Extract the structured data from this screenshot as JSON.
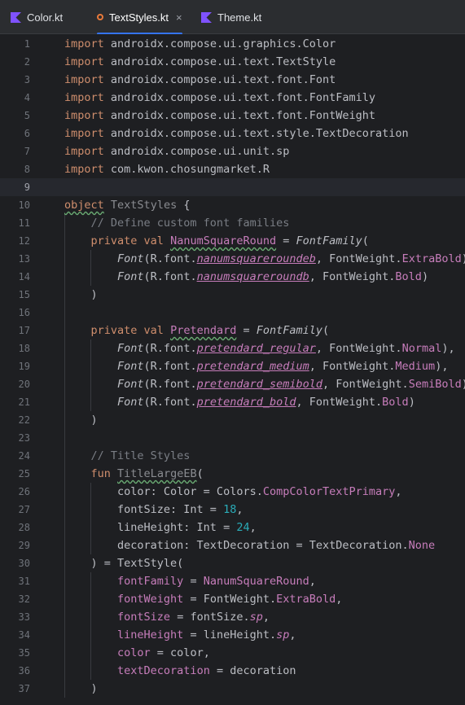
{
  "tabs": [
    {
      "label": "Color.kt",
      "active": false,
      "modified": false
    },
    {
      "label": "TextStyles.kt",
      "active": true,
      "modified": true
    },
    {
      "label": "Theme.kt",
      "active": false,
      "modified": false
    }
  ],
  "colors": {
    "accent": "#3574f0",
    "modified": "#e8793a",
    "kotlin_icon": "#7f52ff"
  },
  "current_line": 9,
  "lines": [
    [
      {
        "t": "import",
        "c": "kw"
      },
      {
        "t": " androidx.compose.ui.graphics.Color",
        "c": "plain"
      }
    ],
    [
      {
        "t": "import",
        "c": "kw"
      },
      {
        "t": " androidx.compose.ui.text.TextStyle",
        "c": "plain"
      }
    ],
    [
      {
        "t": "import",
        "c": "kw"
      },
      {
        "t": " androidx.compose.ui.text.font.Font",
        "c": "plain"
      }
    ],
    [
      {
        "t": "import",
        "c": "kw"
      },
      {
        "t": " androidx.compose.ui.text.font.FontFamily",
        "c": "plain"
      }
    ],
    [
      {
        "t": "import",
        "c": "kw"
      },
      {
        "t": " androidx.compose.ui.text.font.FontWeight",
        "c": "plain"
      }
    ],
    [
      {
        "t": "import",
        "c": "kw"
      },
      {
        "t": " androidx.compose.ui.text.style.TextDecoration",
        "c": "plain"
      }
    ],
    [
      {
        "t": "import",
        "c": "kw"
      },
      {
        "t": " androidx.compose.ui.unit.sp",
        "c": "plain"
      }
    ],
    [
      {
        "t": "import",
        "c": "kw"
      },
      {
        "t": " com.kwon.chosungmarket.R",
        "c": "plain"
      }
    ],
    [],
    [
      {
        "t": "object",
        "c": "kw typo"
      },
      {
        "t": " ",
        "c": "plain"
      },
      {
        "t": "TextStyles",
        "c": "unused"
      },
      {
        "t": " {",
        "c": "plain"
      }
    ],
    [
      {
        "t": "    // Define custom font families",
        "c": "cm"
      }
    ],
    [
      {
        "t": "    ",
        "c": "plain"
      },
      {
        "t": "private val",
        "c": "kw"
      },
      {
        "t": " ",
        "c": "plain"
      },
      {
        "t": "NanumSquareRound",
        "c": "prop typo"
      },
      {
        "t": " = ",
        "c": "plain"
      },
      {
        "t": "FontFamily",
        "c": "fn-i"
      },
      {
        "t": "(",
        "c": "plain"
      }
    ],
    [
      {
        "t": "        ",
        "c": "plain"
      },
      {
        "t": "Font",
        "c": "fn-i"
      },
      {
        "t": "(R.font.",
        "c": "plain"
      },
      {
        "t": "nanumsquareroundeb",
        "c": "prop-iu"
      },
      {
        "t": ", FontWeight.",
        "c": "plain"
      },
      {
        "t": "ExtraBold",
        "c": "prop"
      },
      {
        "t": "),",
        "c": "plain"
      }
    ],
    [
      {
        "t": "        ",
        "c": "plain"
      },
      {
        "t": "Font",
        "c": "fn-i"
      },
      {
        "t": "(R.font.",
        "c": "plain"
      },
      {
        "t": "nanumsquareroundb",
        "c": "prop-iu"
      },
      {
        "t": ", FontWeight.",
        "c": "plain"
      },
      {
        "t": "Bold",
        "c": "prop"
      },
      {
        "t": ")",
        "c": "plain"
      }
    ],
    [
      {
        "t": "    )",
        "c": "plain"
      }
    ],
    [],
    [
      {
        "t": "    ",
        "c": "plain"
      },
      {
        "t": "private val",
        "c": "kw"
      },
      {
        "t": " ",
        "c": "plain"
      },
      {
        "t": "Pretendard",
        "c": "prop typo"
      },
      {
        "t": " = ",
        "c": "plain"
      },
      {
        "t": "FontFamily",
        "c": "fn-i"
      },
      {
        "t": "(",
        "c": "plain"
      }
    ],
    [
      {
        "t": "        ",
        "c": "plain"
      },
      {
        "t": "Font",
        "c": "fn-i"
      },
      {
        "t": "(R.font.",
        "c": "plain"
      },
      {
        "t": "pretendard_regular",
        "c": "prop-iu"
      },
      {
        "t": ", FontWeight.",
        "c": "plain"
      },
      {
        "t": "Normal",
        "c": "prop"
      },
      {
        "t": "),",
        "c": "plain"
      }
    ],
    [
      {
        "t": "        ",
        "c": "plain"
      },
      {
        "t": "Font",
        "c": "fn-i"
      },
      {
        "t": "(R.font.",
        "c": "plain"
      },
      {
        "t": "pretendard_medium",
        "c": "prop-iu"
      },
      {
        "t": ", FontWeight.",
        "c": "plain"
      },
      {
        "t": "Medium",
        "c": "prop"
      },
      {
        "t": "),",
        "c": "plain"
      }
    ],
    [
      {
        "t": "        ",
        "c": "plain"
      },
      {
        "t": "Font",
        "c": "fn-i"
      },
      {
        "t": "(R.font.",
        "c": "plain"
      },
      {
        "t": "pretendard_semibold",
        "c": "prop-iu"
      },
      {
        "t": ", FontWeight.",
        "c": "plain"
      },
      {
        "t": "SemiBold",
        "c": "prop"
      },
      {
        "t": "),",
        "c": "plain"
      }
    ],
    [
      {
        "t": "        ",
        "c": "plain"
      },
      {
        "t": "Font",
        "c": "fn-i"
      },
      {
        "t": "(R.font.",
        "c": "plain"
      },
      {
        "t": "pretendard_bold",
        "c": "prop-iu"
      },
      {
        "t": ", FontWeight.",
        "c": "plain"
      },
      {
        "t": "Bold",
        "c": "prop"
      },
      {
        "t": ")",
        "c": "plain"
      }
    ],
    [
      {
        "t": "    )",
        "c": "plain"
      }
    ],
    [],
    [
      {
        "t": "    // Title Styles",
        "c": "cm"
      }
    ],
    [
      {
        "t": "    ",
        "c": "plain"
      },
      {
        "t": "fun",
        "c": "kw"
      },
      {
        "t": " ",
        "c": "plain"
      },
      {
        "t": "TitleLargeEB",
        "c": "unused typo"
      },
      {
        "t": "(",
        "c": "plain"
      }
    ],
    [
      {
        "t": "        color: Color = Colors.",
        "c": "plain"
      },
      {
        "t": "CompColorTextPrimary",
        "c": "prop"
      },
      {
        "t": ",",
        "c": "plain"
      }
    ],
    [
      {
        "t": "        fontSize: Int = ",
        "c": "plain"
      },
      {
        "t": "18",
        "c": "num"
      },
      {
        "t": ",",
        "c": "plain"
      }
    ],
    [
      {
        "t": "        lineHeight: Int = ",
        "c": "plain"
      },
      {
        "t": "24",
        "c": "num"
      },
      {
        "t": ",",
        "c": "plain"
      }
    ],
    [
      {
        "t": "        decoration: TextDecoration = TextDecoration.",
        "c": "plain"
      },
      {
        "t": "None",
        "c": "prop"
      }
    ],
    [
      {
        "t": "    ) = TextStyle(",
        "c": "plain"
      }
    ],
    [
      {
        "t": "        ",
        "c": "plain"
      },
      {
        "t": "fontFamily",
        "c": "prop"
      },
      {
        "t": " = ",
        "c": "plain"
      },
      {
        "t": "NanumSquareRound",
        "c": "prop"
      },
      {
        "t": ",",
        "c": "plain"
      }
    ],
    [
      {
        "t": "        ",
        "c": "plain"
      },
      {
        "t": "fontWeight",
        "c": "prop"
      },
      {
        "t": " = FontWeight.",
        "c": "plain"
      },
      {
        "t": "ExtraBold",
        "c": "prop"
      },
      {
        "t": ",",
        "c": "plain"
      }
    ],
    [
      {
        "t": "        ",
        "c": "plain"
      },
      {
        "t": "fontSize",
        "c": "prop"
      },
      {
        "t": " = fontSize.",
        "c": "plain"
      },
      {
        "t": "sp",
        "c": "prop-i"
      },
      {
        "t": ",",
        "c": "plain"
      }
    ],
    [
      {
        "t": "        ",
        "c": "plain"
      },
      {
        "t": "lineHeight",
        "c": "prop"
      },
      {
        "t": " = lineHeight.",
        "c": "plain"
      },
      {
        "t": "sp",
        "c": "prop-i"
      },
      {
        "t": ",",
        "c": "plain"
      }
    ],
    [
      {
        "t": "        ",
        "c": "plain"
      },
      {
        "t": "color",
        "c": "prop"
      },
      {
        "t": " = color,",
        "c": "plain"
      }
    ],
    [
      {
        "t": "        ",
        "c": "plain"
      },
      {
        "t": "textDecoration",
        "c": "prop"
      },
      {
        "t": " = decoration",
        "c": "plain"
      }
    ],
    [
      {
        "t": "    )",
        "c": "plain"
      }
    ]
  ]
}
